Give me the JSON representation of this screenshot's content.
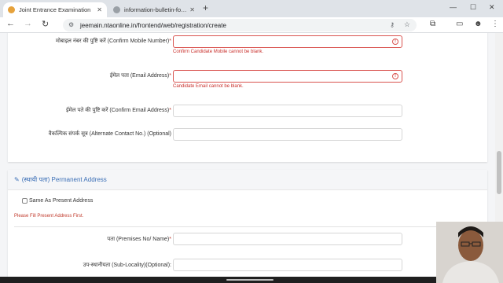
{
  "browser": {
    "tabs": [
      {
        "title": "Joint Entrance Examination",
        "active": true
      },
      {
        "title": "information-bulletin-for-je",
        "active": false
      }
    ],
    "url": "jeemain.ntaonline.in/frontend/web/registration/create"
  },
  "form": {
    "confirm_mobile_label": "मोबाइल नंबर की पुष्टि करें (Confirm Mobile Number)",
    "confirm_mobile_error": "Confirm Candidate Mobile cannot be blank.",
    "email_label": "ईमेल पता (Email Address)",
    "email_error": "Candidate Email cannot be blank.",
    "confirm_email_label": "ईमेल पते की पुष्टि करें (Confirm Email Address)",
    "alternate_contact_label": "वैकल्पिक संपर्क सूत्र (Alternate Contact No.) (Optional)",
    "required_mark": "*"
  },
  "permanent_address": {
    "heading": "(स्थायी पता) Permanent Address",
    "same_as_present_label": "Same As Present Address",
    "hint": "Please Fill Present Address First.",
    "premises_label": "पता (Premises No/ Name)",
    "sub_locality_label": "उप-स्थानीयता (Sub-Locality)(Optional):"
  },
  "colors": {
    "accent": "#3b6fb6",
    "error": "#c9302c"
  }
}
